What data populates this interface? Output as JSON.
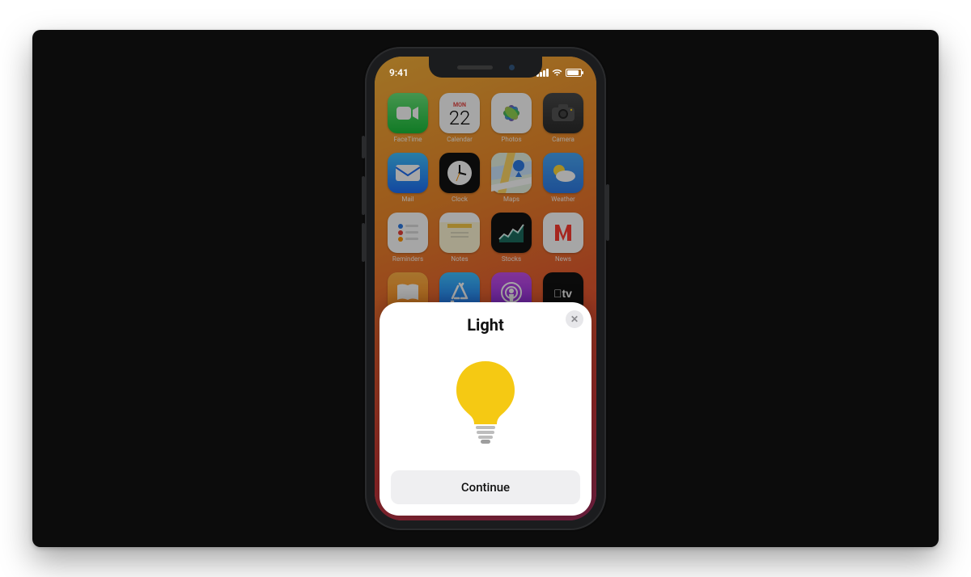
{
  "status": {
    "time": "9:41"
  },
  "calendar_icon": {
    "dow": "MON",
    "dom": "22"
  },
  "apps": [
    {
      "label": "FaceTime"
    },
    {
      "label": "Calendar"
    },
    {
      "label": "Photos"
    },
    {
      "label": "Camera"
    },
    {
      "label": "Mail"
    },
    {
      "label": "Clock"
    },
    {
      "label": "Maps"
    },
    {
      "label": "Weather"
    },
    {
      "label": "Reminders"
    },
    {
      "label": "Notes"
    },
    {
      "label": "Stocks"
    },
    {
      "label": "News"
    },
    {
      "label": "Books"
    },
    {
      "label": "App Store"
    },
    {
      "label": "Podcasts"
    },
    {
      "label": "TV"
    }
  ],
  "sheet": {
    "title": "Light",
    "continue_label": "Continue",
    "close_label": "✕",
    "bulb_color": "#f5c913"
  }
}
